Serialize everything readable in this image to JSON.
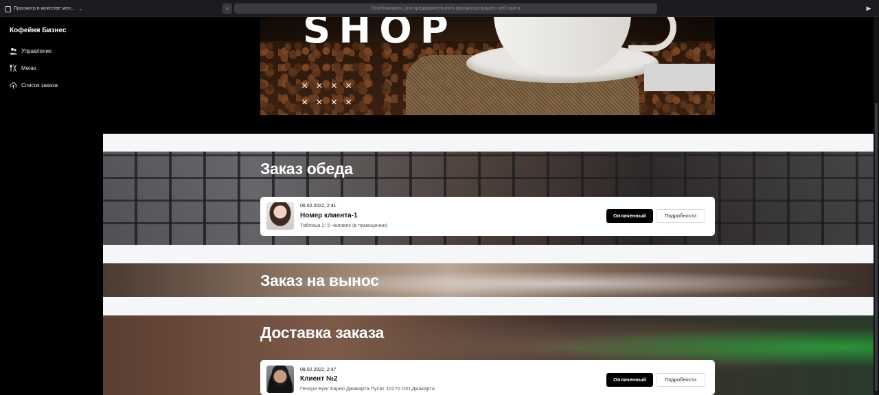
{
  "topbar": {
    "preview_label": "Просмотр в качестве мен...",
    "url_placeholder": "Опубликовать для предварительного просмотра вашего веб-сайта"
  },
  "sidebar": {
    "brand": "Кофейня Бизнес",
    "items": [
      {
        "label": "Управление",
        "icon": "people-icon"
      },
      {
        "label": "Меню",
        "icon": "utensils-icon"
      },
      {
        "label": "Список заказа",
        "icon": "cloud-upload-icon"
      }
    ]
  },
  "hero": {
    "word": "SHOP",
    "crosses_row1": "××××",
    "crosses_row2": "××××"
  },
  "sections": {
    "lunch": {
      "title": "Заказ обеда",
      "order": {
        "timestamp": "06.02.2022, 2:41",
        "name": "Номер клиента-1",
        "description": "Таблица 2: 5 человек (в помещении)",
        "status": "Оплаченный",
        "details": "Подробности"
      }
    },
    "takeaway": {
      "title": "Заказ на вынос"
    },
    "delivery": {
      "title": "Доставка заказа",
      "order": {
        "timestamp": "08.02.2022, 2:47",
        "name": "Клиент №2",
        "description": "Гелора Бунг Карно Джакарта Пусат 10270 DKI Джакарта",
        "status": "Оплаченный",
        "details": "Подробности"
      }
    }
  },
  "colors": {
    "sidebar_bg": "#000000",
    "band_bg": "#f4f6f8",
    "primary_button": "#000000"
  }
}
